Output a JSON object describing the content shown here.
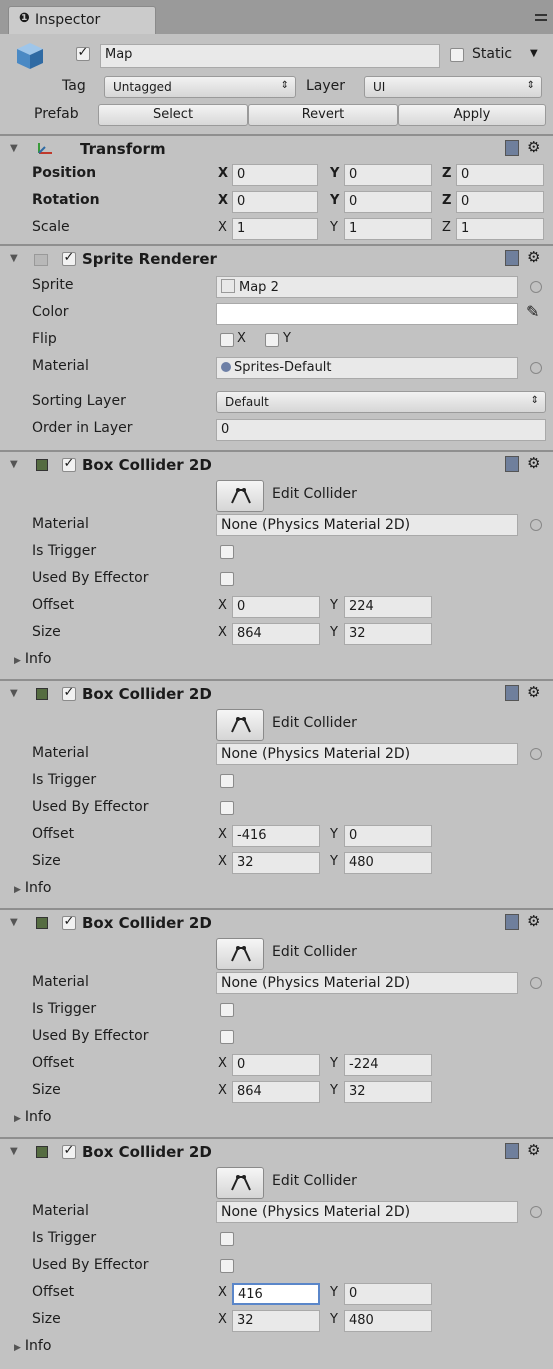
{
  "tab": {
    "icon": "info-circle-icon",
    "label": "Inspector"
  },
  "object": {
    "name": "Map",
    "active": true,
    "static_label": "Static",
    "static_checked": false,
    "tag_label": "Tag",
    "tag_value": "Untagged",
    "layer_label": "Layer",
    "layer_value": "UI",
    "prefab_label": "Prefab",
    "prefab_select": "Select",
    "prefab_revert": "Revert",
    "prefab_apply": "Apply"
  },
  "transform": {
    "title": "Transform",
    "rows": [
      {
        "label": "Position",
        "x": "0",
        "y": "0",
        "z": "0"
      },
      {
        "label": "Rotation",
        "x": "0",
        "y": "0",
        "z": "0"
      },
      {
        "label": "Scale",
        "x": "1",
        "y": "1",
        "z": "1"
      }
    ],
    "axes": {
      "x": "X",
      "y": "Y",
      "z": "Z"
    }
  },
  "sprite_renderer": {
    "title": "Sprite Renderer",
    "enabled": true,
    "sprite_label": "Sprite",
    "sprite_value": "Map 2",
    "color_label": "Color",
    "color_value": "#ffffff",
    "flip_label": "Flip",
    "flip_x": "X",
    "flip_y": "Y",
    "material_label": "Material",
    "material_value": "Sprites-Default",
    "sorting_layer_label": "Sorting Layer",
    "sorting_layer_value": "Default",
    "order_label": "Order in Layer",
    "order_value": "0"
  },
  "box_colliders": [
    {
      "title": "Box Collider 2D",
      "edit_label": "Edit Collider",
      "material_label": "Material",
      "material_value": "None (Physics Material 2D)",
      "is_trigger_label": "Is Trigger",
      "effector_label": "Used By Effector",
      "offset_label": "Offset",
      "offset_x": "0",
      "offset_y": "224",
      "size_label": "Size",
      "size_x": "864",
      "size_y": "32",
      "info_label": "Info",
      "x": "X",
      "y": "Y"
    },
    {
      "title": "Box Collider 2D",
      "edit_label": "Edit Collider",
      "material_label": "Material",
      "material_value": "None (Physics Material 2D)",
      "is_trigger_label": "Is Trigger",
      "effector_label": "Used By Effector",
      "offset_label": "Offset",
      "offset_x": "-416",
      "offset_y": "0",
      "size_label": "Size",
      "size_x": "32",
      "size_y": "480",
      "info_label": "Info",
      "x": "X",
      "y": "Y"
    },
    {
      "title": "Box Collider 2D",
      "edit_label": "Edit Collider",
      "material_label": "Material",
      "material_value": "None (Physics Material 2D)",
      "is_trigger_label": "Is Trigger",
      "effector_label": "Used By Effector",
      "offset_label": "Offset",
      "offset_x": "0",
      "offset_y": "-224",
      "size_label": "Size",
      "size_x": "864",
      "size_y": "32",
      "info_label": "Info",
      "x": "X",
      "y": "Y"
    },
    {
      "title": "Box Collider 2D",
      "edit_label": "Edit Collider",
      "material_label": "Material",
      "material_value": "None (Physics Material 2D)",
      "is_trigger_label": "Is Trigger",
      "effector_label": "Used By Effector",
      "offset_label": "Offset",
      "offset_x": "416",
      "offset_y": "0",
      "size_label": "Size",
      "size_x": "32",
      "size_y": "480",
      "info_label": "Info",
      "x": "X",
      "y": "Y"
    }
  ]
}
